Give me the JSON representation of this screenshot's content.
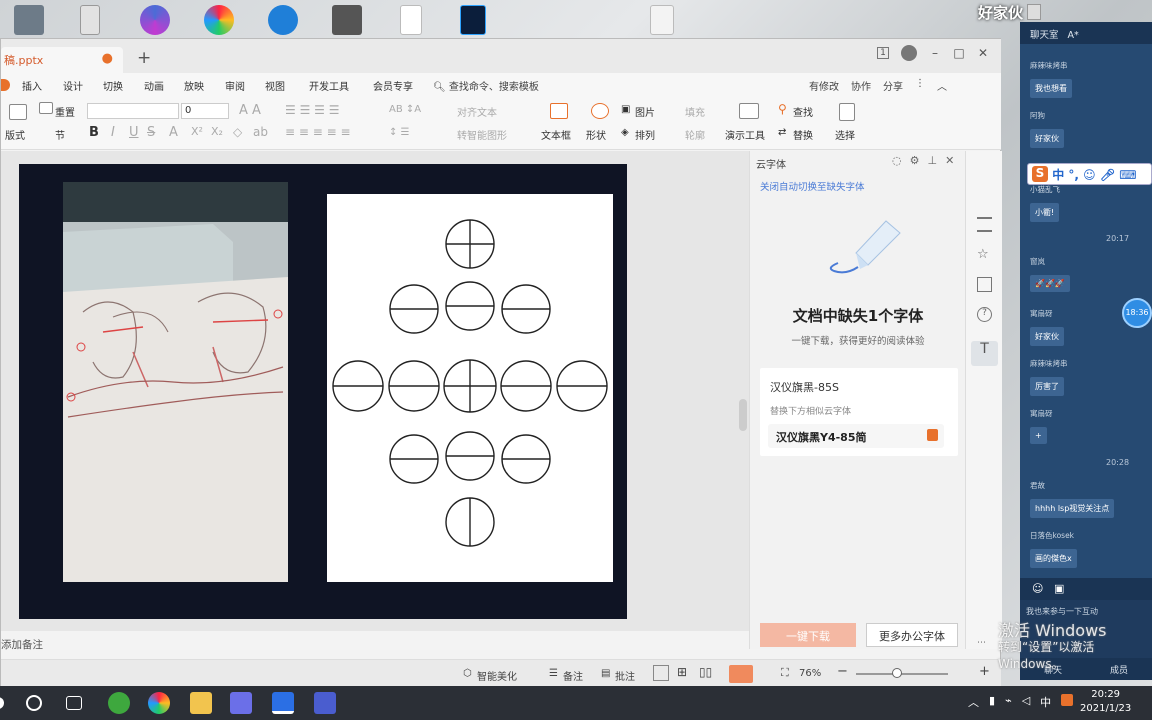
{
  "desktop": {
    "user_name": "好家伙"
  },
  "window": {
    "doc_tab": "稿.pptx",
    "new_tab_symbol": "+",
    "page_indicator": "1",
    "controls": {
      "minimize": "–",
      "maximize": "□",
      "close": "✕"
    }
  },
  "menu": {
    "items": [
      "插入",
      "设计",
      "切换",
      "动画",
      "放映",
      "审阅",
      "视图",
      "开发工具",
      "会员专享"
    ],
    "search": "查找命令、搜索模板",
    "right": [
      "有修改",
      "协作",
      "分享"
    ]
  },
  "ribbon": {
    "layout": "版式",
    "reset": "重置",
    "section": "节",
    "font_size": "0",
    "align_text": "对齐文本",
    "smartart": "转智能图形",
    "textbox": "文本框",
    "shape": "形状",
    "picture": "图片",
    "fill": "填充",
    "arrange": "排列",
    "outline": "轮廓",
    "present_tools": "演示工具",
    "find": "查找",
    "replace": "替换",
    "select": "选择"
  },
  "font_panel": {
    "title": "云字体",
    "link": "关闭自动切换至缺失字体",
    "heading": "文档中缺失1个字体",
    "sub": "一键下载，获得更好的阅读体验",
    "missing_font": "汉仪旗黑-85S",
    "hint": "替换下方相似云字体",
    "substitute": "汉仪旗黑Y4-85简",
    "download_btn": "一键下载",
    "more_btn": "更多办公字体"
  },
  "notes": {
    "placeholder": "添加备注"
  },
  "status": {
    "beautify": "智能美化",
    "notes": "备注",
    "comments": "批注",
    "zoom": "76%"
  },
  "chat": {
    "header": "聊天室",
    "header_icon": "A*",
    "messages": [
      {
        "user": "麻辣味烤串",
        "text": "我也想看"
      },
      {
        "user": "阿狗",
        "text": "好家伙"
      },
      {
        "user": "小猫乱飞",
        "text": "小衢!"
      },
      {
        "user": "窗岚",
        "text": "🚀🚀🚀"
      },
      {
        "user": "寓扇砑",
        "text": "好家伙"
      },
      {
        "user": "麻辣味烤串",
        "text": "厉害了"
      },
      {
        "user": "寓扇砑",
        "text": "+"
      },
      {
        "user": "君故",
        "text": "hhhh lsp视觉关注点"
      },
      {
        "user": "日落色kosek",
        "text": "画的傑色x"
      }
    ],
    "times": [
      "20:17",
      "20:28"
    ],
    "time_bubble": "18:36",
    "input_placeholder": "我也来参与一下互动",
    "tabs": [
      "聊天",
      "成员"
    ]
  },
  "ime": {
    "label": "中"
  },
  "watermark": {
    "line1": "激活 Windows",
    "line2": "转到“设置”以激活 Windows。"
  },
  "taskbar": {
    "time": "20:29",
    "date": "2021/1/23",
    "ime": "中"
  },
  "colors": {
    "accent": "#e8712c",
    "link": "#4a7bd6",
    "chat_bg": "#264a72",
    "slide_bg": "#0f1424"
  }
}
